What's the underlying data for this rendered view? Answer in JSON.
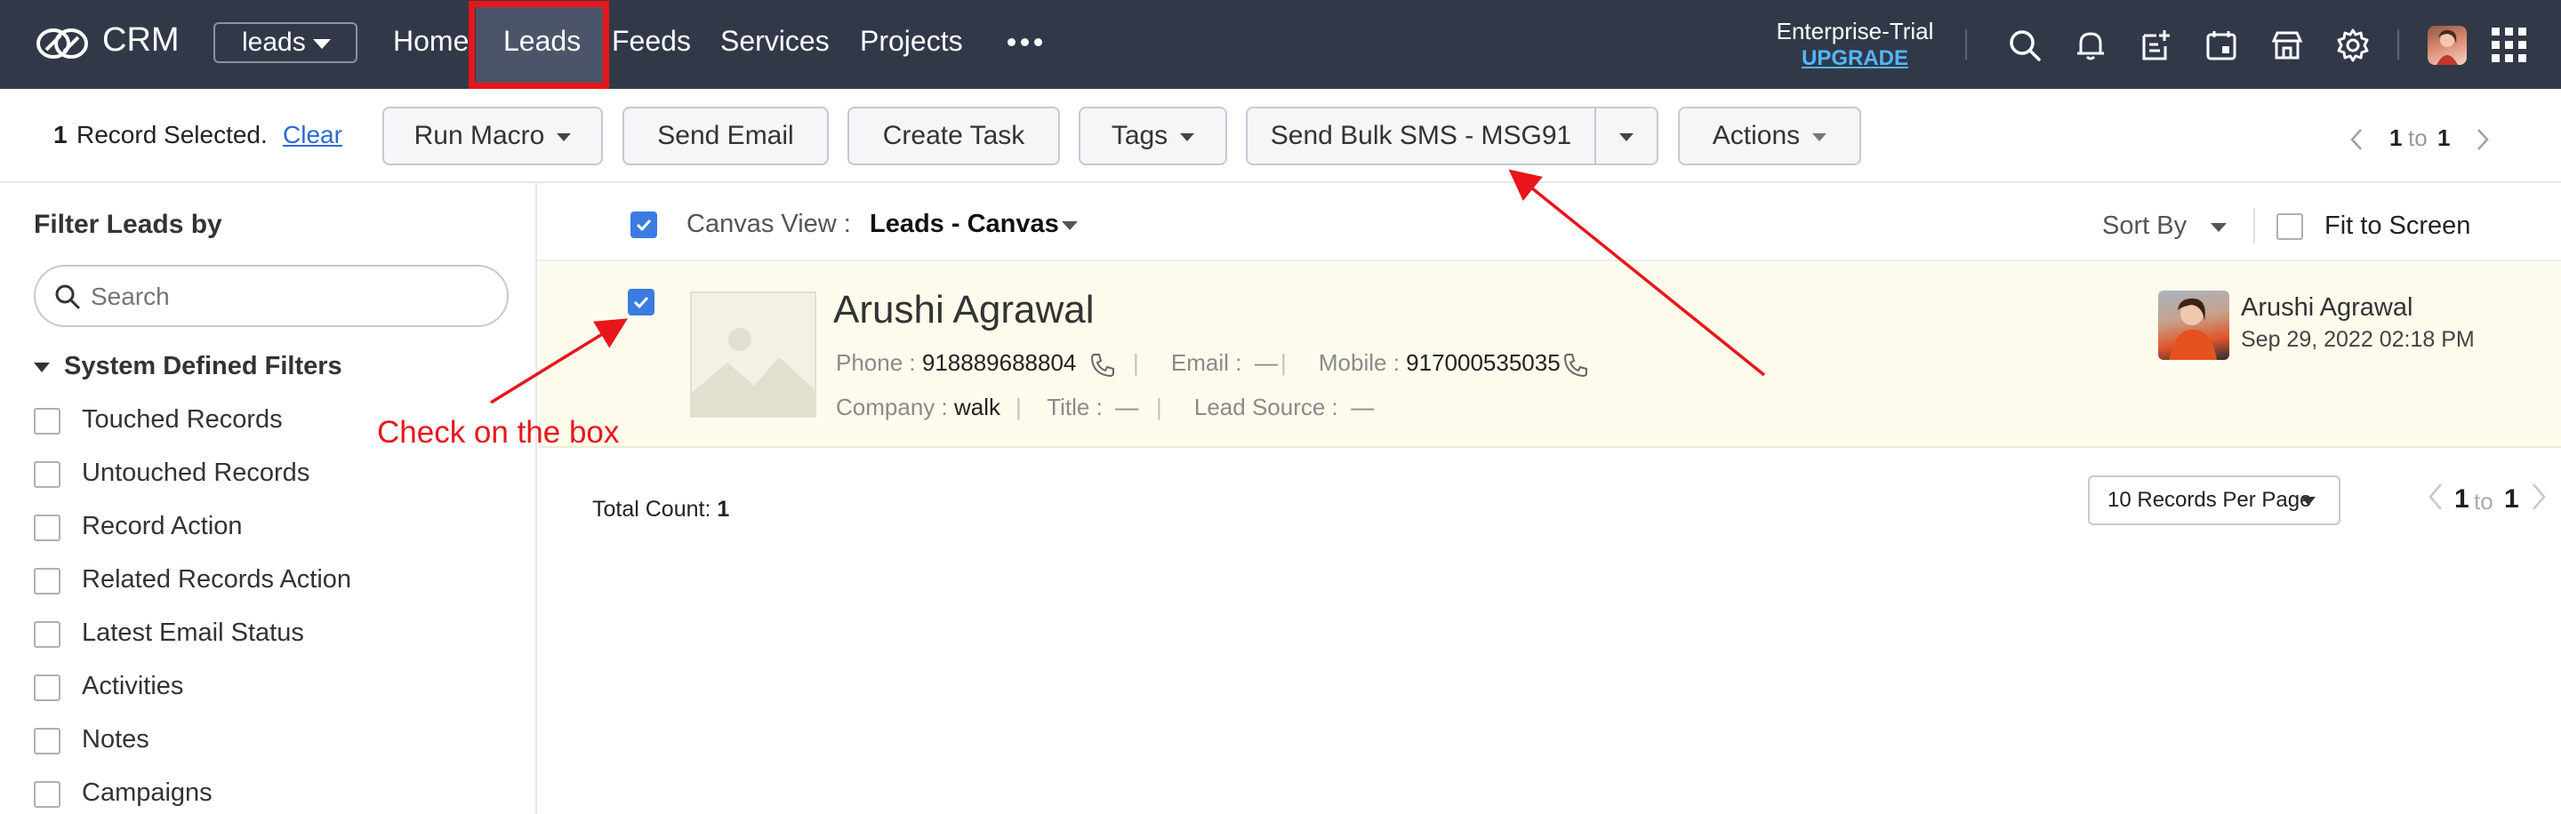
{
  "topbar": {
    "brand": "CRM",
    "module_select": "leads",
    "nav": {
      "home": "Home",
      "leads": "Leads",
      "feeds": "Feeds",
      "services": "Services",
      "projects": "Projects"
    },
    "edition": "Enterprise-Trial",
    "upgrade": "UPGRADE",
    "icons": [
      "search-icon",
      "bell-icon",
      "add-note-icon",
      "calendar-icon",
      "marketplace-icon",
      "gear-icon",
      "apps-grid-icon"
    ]
  },
  "toolbar": {
    "selected_count": "1",
    "selected_label": "Record Selected.",
    "clear": "Clear",
    "run_macro": "Run Macro",
    "send_email": "Send Email",
    "create_task": "Create Task",
    "tags": "Tags",
    "send_bulk_sms": "Send Bulk SMS - MSG91",
    "actions": "Actions",
    "pager": {
      "from": "1",
      "to_word": "to",
      "to": "1"
    }
  },
  "filters": {
    "title": "Filter Leads by",
    "search_placeholder": "Search",
    "section": "System Defined Filters",
    "items": [
      "Touched Records",
      "Untouched Records",
      "Record Action",
      "Related Records Action",
      "Latest Email Status",
      "Activities",
      "Notes",
      "Campaigns"
    ]
  },
  "canvas": {
    "view_label": "Canvas View :",
    "view_value": "Leads - Canvas",
    "sort_by": "Sort By",
    "fit_to_screen": "Fit to Screen"
  },
  "record": {
    "name": "Arushi Agrawal",
    "phone_label": "Phone :",
    "phone": "918889688804",
    "email_label": "Email :",
    "email": "—",
    "mobile_label": "Mobile :",
    "mobile": "917000535035",
    "company_label": "Company :",
    "company": "walk",
    "title_label": "Title :",
    "title": "—",
    "lead_source_label": "Lead Source :",
    "lead_source": "—",
    "owner_name": "Arushi Agrawal",
    "owner_date": "Sep 29, 2022 02:18 PM",
    "checked": true
  },
  "footer": {
    "total_label": "Total Count:",
    "total_value": "1",
    "records_per_page": "10 Records Per Page",
    "pager": {
      "from": "1",
      "to_word": "to",
      "to": "1"
    }
  },
  "annotation": {
    "text": "Check on the box",
    "color": "#e8161a"
  },
  "colors": {
    "topbar_bg": "#313949",
    "accent_blue": "#3b7ce0",
    "highlight_red": "#e8161a",
    "record_bg": "#fdfbec"
  }
}
